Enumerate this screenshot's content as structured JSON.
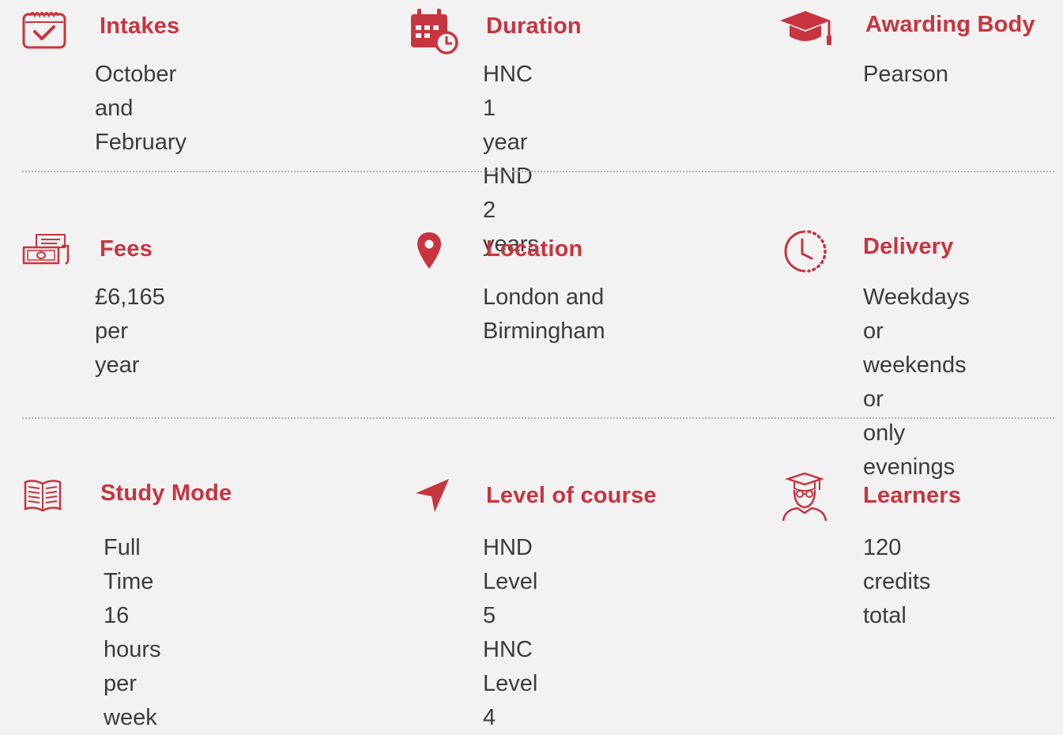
{
  "colors": {
    "accent": "#c8343f",
    "text": "#3c3c3c",
    "background": "#f2f2f2",
    "divider": "#b4b4b4"
  },
  "items": [
    {
      "icon": "calendar-check-icon",
      "title": "Intakes",
      "value": "October and\nFebruary"
    },
    {
      "icon": "calendar-clock-icon",
      "title": "Duration",
      "value": "HNC 1 year\nHND 2 years"
    },
    {
      "icon": "graduation-cap-icon",
      "title": "Awarding Body",
      "value": "Pearson"
    },
    {
      "icon": "money-icon",
      "title": "Fees",
      "value": "£6,165 per year"
    },
    {
      "icon": "map-pin-icon",
      "title": "Location",
      "value": "London and\nBirmingham"
    },
    {
      "icon": "clock-icon",
      "title": "Delivery",
      "value": "Weekdays or\nweekends or\nonly evenings"
    },
    {
      "icon": "open-book-icon",
      "title": "Study Mode",
      "value": "Full Time\n16 hours per week"
    },
    {
      "icon": "navigation-arrow-icon",
      "title": "Level of course",
      "value": "HND Level 5\nHNC Level 4"
    },
    {
      "icon": "student-icon",
      "title": "Learners",
      "value": "120 credits\n total"
    }
  ]
}
